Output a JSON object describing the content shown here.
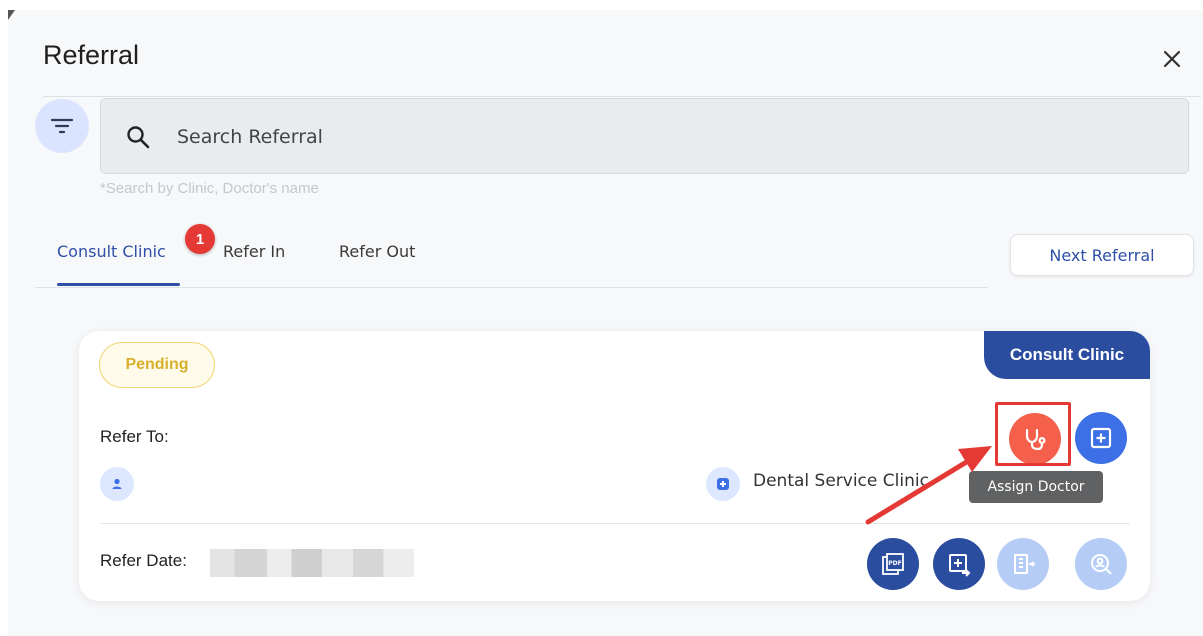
{
  "header": {
    "title": "Referral"
  },
  "search": {
    "placeholder": "Search Referral",
    "hint": "*Search by Clinic, Doctor's name"
  },
  "tabs": [
    {
      "label": "Consult Clinic",
      "active": true,
      "badge": "1"
    },
    {
      "label": "Refer In",
      "active": false
    },
    {
      "label": "Refer Out",
      "active": false
    }
  ],
  "next_referral_label": "Next Referral",
  "card": {
    "tag": "Consult Clinic",
    "status": "Pending",
    "refer_to_label": "Refer To:",
    "clinic_name": "Dental Service Clinic",
    "refer_date_label": "Refer Date:",
    "tooltip": "Assign Doctor",
    "actions": [
      "stethoscope-icon",
      "add-box-icon",
      "pdf-icon",
      "export-icon",
      "hospital-icon",
      "person-search-icon"
    ]
  },
  "colors": {
    "primary": "#2a4da0",
    "accent": "#3d6fe6",
    "danger": "#e53935",
    "assign": "#f4604b",
    "pending": "#d8b02d",
    "disabled": "#b5ccf6"
  }
}
